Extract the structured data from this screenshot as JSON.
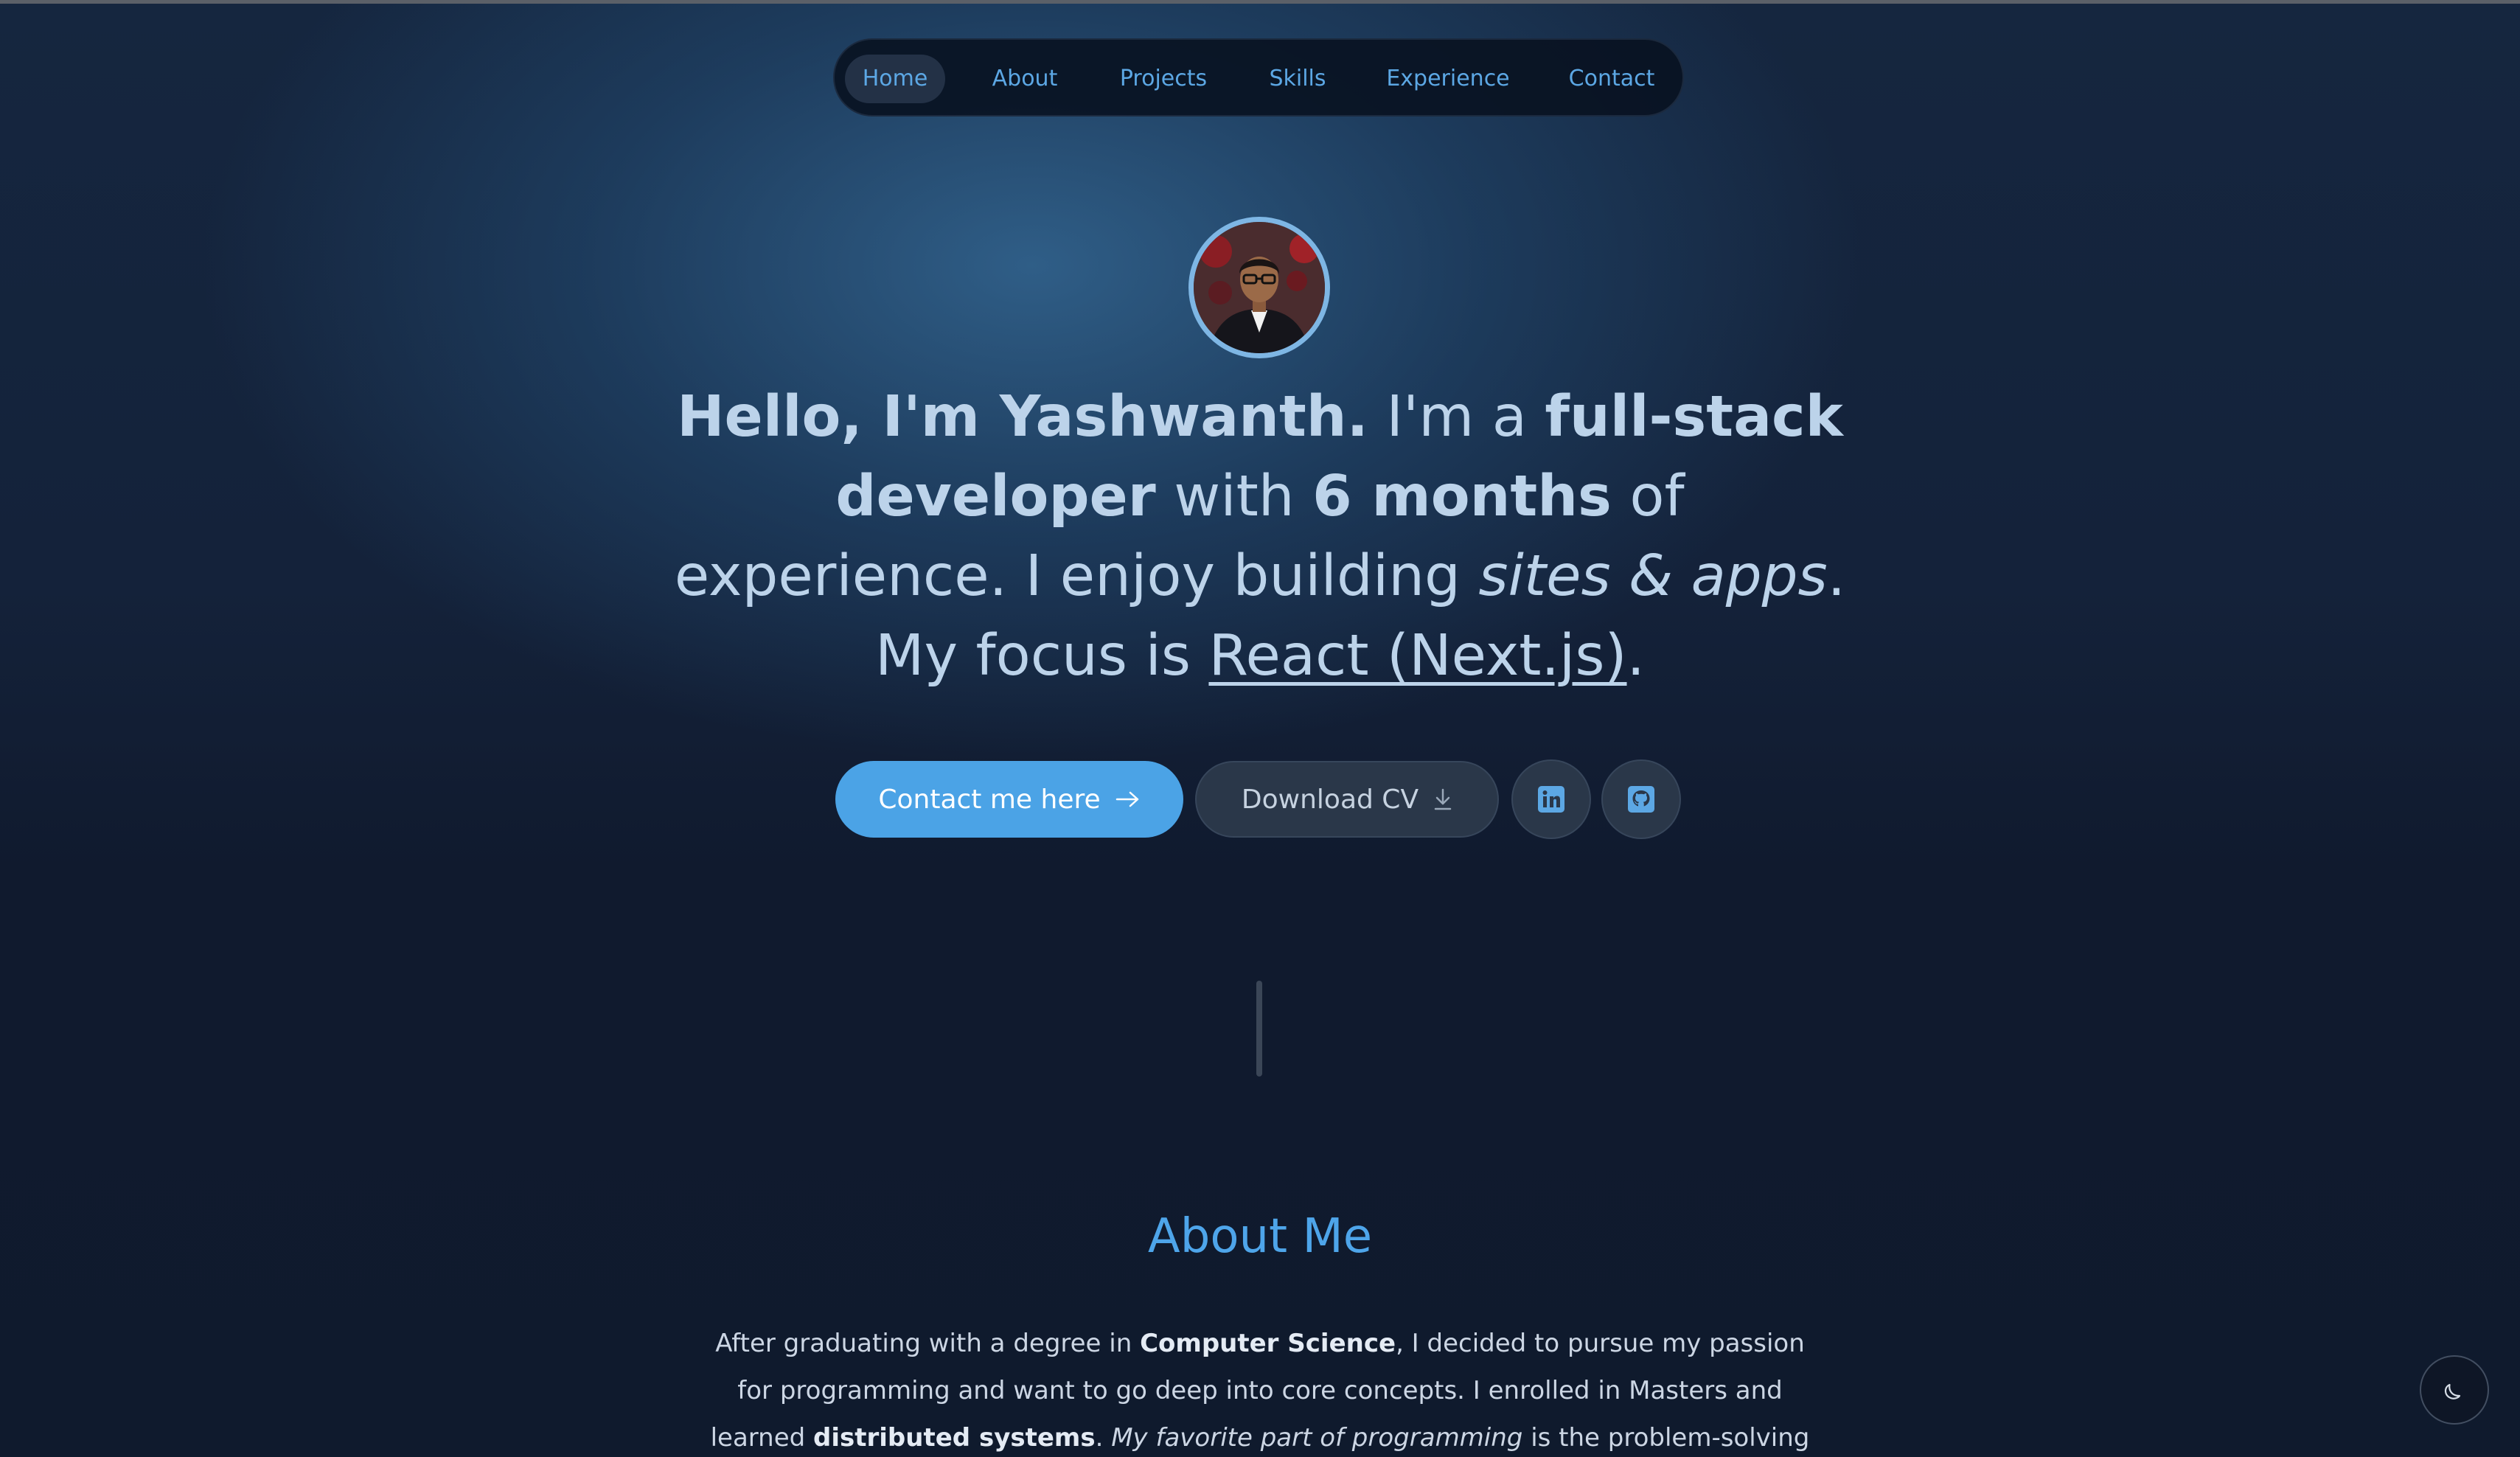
{
  "nav": {
    "items": [
      {
        "label": "Home",
        "active": true
      },
      {
        "label": "About",
        "active": false
      },
      {
        "label": "Projects",
        "active": false
      },
      {
        "label": "Skills",
        "active": false
      },
      {
        "label": "Experience",
        "active": false
      },
      {
        "label": "Contact",
        "active": false
      }
    ]
  },
  "hero": {
    "greeting": "Hello, I'm Yashwanth.",
    "t1": " I'm a ",
    "role": "full-stack developer",
    "t2": " with ",
    "duration": "6 months",
    "t3": " of experience. I enjoy building ",
    "builds": "sites & apps",
    "t4": ". My focus is ",
    "focus": "React (Next.js)",
    "t5": "."
  },
  "buttons": {
    "contact_label": "Contact me here",
    "contact_icon": "arrow-right-icon",
    "cv_label": "Download CV",
    "cv_icon": "download-icon",
    "linkedin_icon": "linkedin-icon",
    "github_icon": "github-icon"
  },
  "about": {
    "title": "About Me",
    "p1": "After graduating with a degree in ",
    "degree": "Computer Science",
    "p2": ", I decided to pursue my passion for programming and want to go deep into core concepts. I enrolled in Masters and learned ",
    "topic": "distributed systems",
    "p3": ". ",
    "favorite": "My favorite part of programming",
    "p4": " is the problem-solving aspect. I"
  },
  "theme_toggle": {
    "icon": "moon-icon"
  },
  "colors": {
    "accent": "#4ba3e6",
    "background": "#101a2e",
    "nav_text": "#5ca7e4",
    "heading_text": "#bcd3ea"
  }
}
